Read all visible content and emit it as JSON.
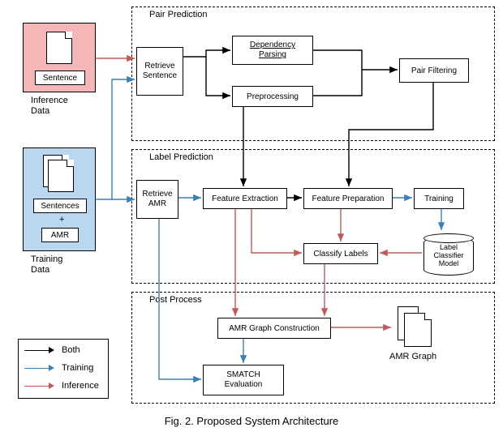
{
  "stages": {
    "pair_prediction": "Pair Prediction",
    "label_prediction": "Label Prediction",
    "post_process": "Post Process"
  },
  "inference_data": {
    "card": "Sentence",
    "label": "Inference\nData"
  },
  "training_data": {
    "card1": "Sentences",
    "card2": "+",
    "card3": "AMR",
    "label": "Training\nData"
  },
  "nodes": {
    "retrieve_sentence": "Retrieve\nSentence",
    "dependency_parsing": "Dependency\nParsing",
    "preprocessing": "Preprocessing",
    "pair_filtering": "Pair Filtering",
    "retrieve_amr": "Retrieve\nAMR",
    "feature_extraction": "Feature Extraction",
    "feature_preparation": "Feature Preparation",
    "training": "Training",
    "classify_labels": "Classify Labels",
    "label_classifier_model": "Label\nClassifier\nModel",
    "amr_graph_construction": "AMR Graph Construction",
    "smatch_evaluation": "SMATCH\nEvaluation",
    "amr_graph": "AMR Graph"
  },
  "legend": {
    "both": "Both",
    "training": "Training",
    "inference": "Inference"
  },
  "caption": "Fig. 2.   Proposed System Architecture",
  "colors": {
    "inference_bg": "#f4b6b6",
    "training_bg": "#b9d7f0",
    "both": "#000000",
    "training_arrow": "#3b7fb5",
    "inference_arrow": "#c15a5a"
  }
}
